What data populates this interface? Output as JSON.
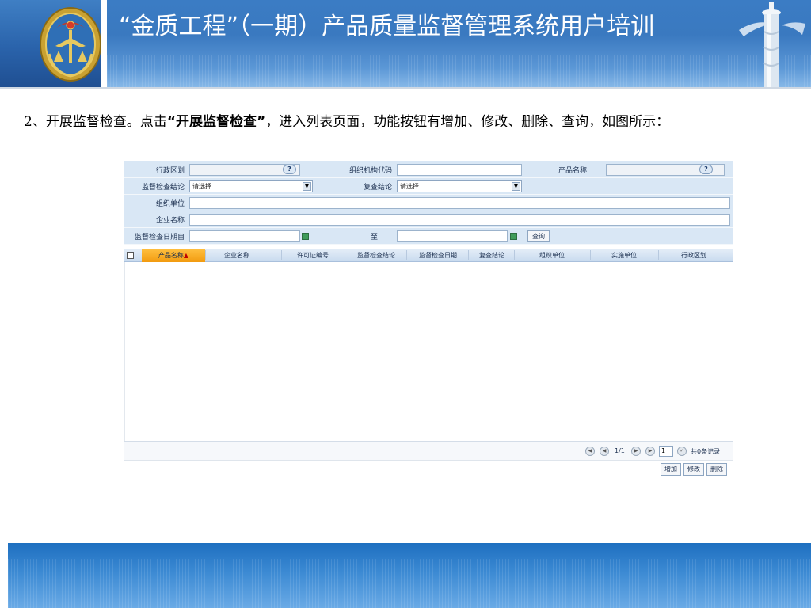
{
  "slide": {
    "title": "“金质工程”（一期）产品质量监督管理系统用户培训",
    "para_prefix": "2、开展监督检查。点击",
    "para_bold": "“开展监督检查”",
    "para_suffix": "，进入列表页面，功能按钮有增加、修改、删除、查询，如图所示："
  },
  "colors": {
    "header_blue": "#3a79c0",
    "row_blue": "#d9e7f5",
    "sorted_header": "#f29b10",
    "footer_blue": "#1e6fc0"
  },
  "query_form": {
    "region_label": "行政区划",
    "org_code_label": "组织机构代码",
    "product_name_label": "产品名称",
    "supervision_result_label": "监督检查结论",
    "supervision_result_value": "请选择",
    "recheck_result_label": "复查结论",
    "recheck_result_value": "请选择",
    "org_unit_label": "组织单位",
    "company_name_label": "企业名称",
    "date_from_label": "监督检查日期自",
    "date_to_label": "至",
    "search_button": "查询",
    "help_icon": "question-icon",
    "calendar_icon": "calendar-icon",
    "help_glyph": "?"
  },
  "grid": {
    "columns": [
      "产品名称",
      "企业名称",
      "许可证编号",
      "监督检查结论",
      "监督检查日期",
      "复查结论",
      "组织单位",
      "实施单位",
      "行政区划"
    ],
    "sort_indicator": "▲",
    "rows": []
  },
  "pager": {
    "page_text": "1/1",
    "page_input": "1",
    "total_text": "共0条记录"
  },
  "actions": {
    "add": "增加",
    "edit": "修改",
    "delete": "删除"
  }
}
